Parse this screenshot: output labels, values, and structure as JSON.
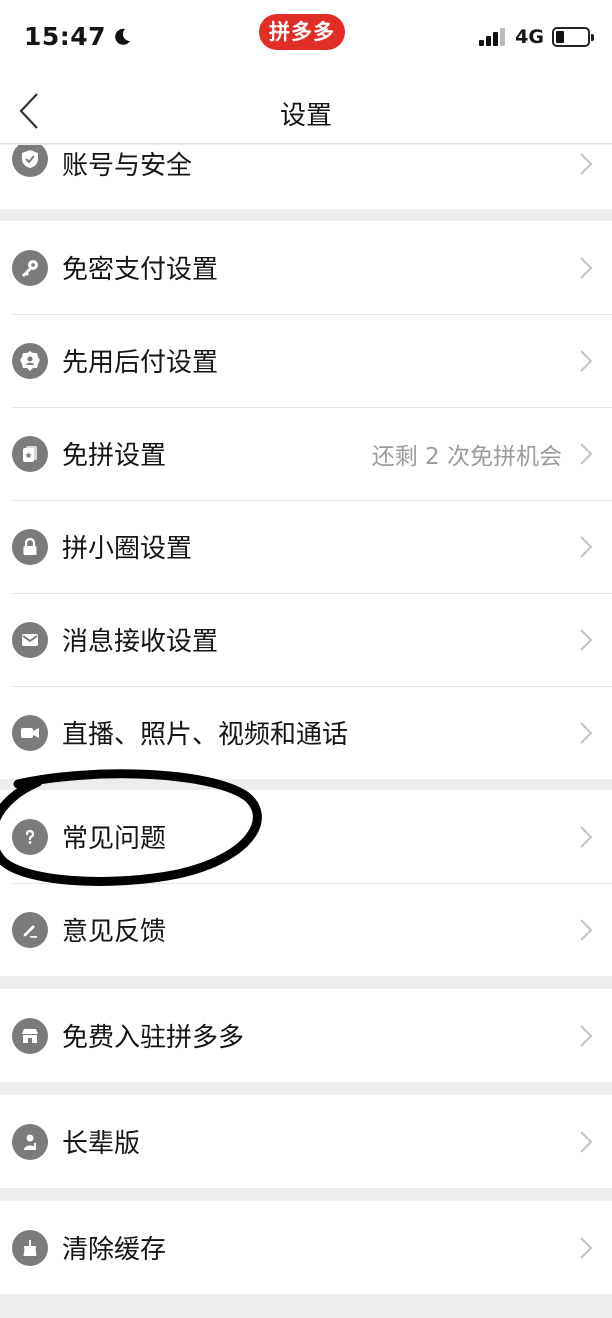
{
  "status_bar": {
    "time": "15:47",
    "brand": "拼多多",
    "network": "4G"
  },
  "nav": {
    "title": "设置"
  },
  "colors": {
    "brand": "#e02e24",
    "icon_bg": "#7b7b7b",
    "text": "#151516",
    "secondary_text": "#9c9c9c",
    "page_bg": "#ededed"
  },
  "sections": [
    {
      "items": [
        {
          "label": "账号与安全",
          "icon": "shield-check-icon"
        }
      ]
    },
    {
      "items": [
        {
          "label": "免密支付设置",
          "icon": "key-icon"
        },
        {
          "label": "先用后付设置",
          "icon": "badge-user-icon"
        },
        {
          "label": "免拼设置",
          "icon": "card-star-icon",
          "value": "还剩 2 次免拼机会"
        },
        {
          "label": "拼小圈设置",
          "icon": "lock-icon"
        },
        {
          "label": "消息接收设置",
          "icon": "mail-icon"
        },
        {
          "label": "直播、照片、视频和通话",
          "icon": "video-camera-icon"
        }
      ]
    },
    {
      "items": [
        {
          "label": "常见问题",
          "icon": "question-icon"
        },
        {
          "label": "意见反馈",
          "icon": "pencil-icon"
        }
      ]
    },
    {
      "items": [
        {
          "label": "免费入驻拼多多",
          "icon": "store-icon"
        }
      ]
    },
    {
      "items": [
        {
          "label": "长辈版",
          "icon": "elder-icon"
        }
      ]
    },
    {
      "items": [
        {
          "label": "清除缓存",
          "icon": "broom-icon"
        }
      ]
    }
  ]
}
